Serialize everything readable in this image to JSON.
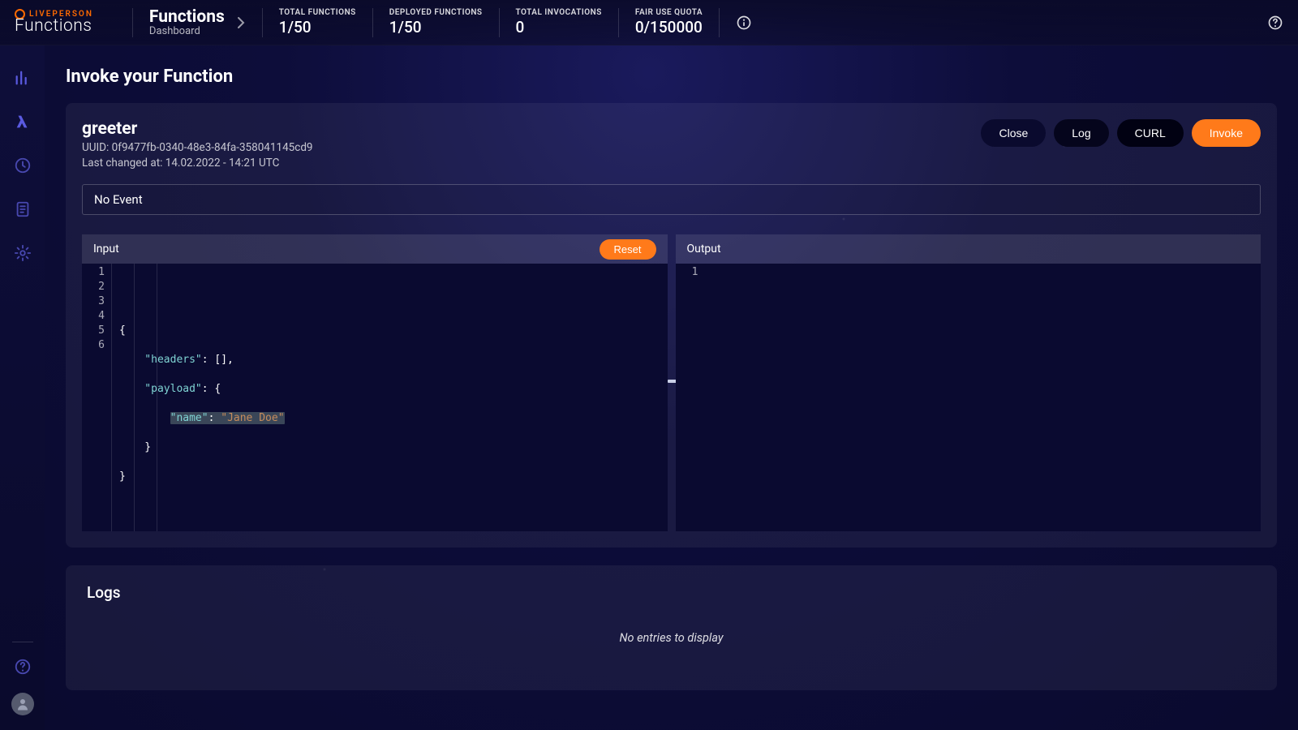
{
  "brand": {
    "word1": "LIVEPERSON",
    "word2": "Functions"
  },
  "breadcrumb": {
    "title": "Functions",
    "subtitle": "Dashboard"
  },
  "stats": {
    "total_functions": {
      "label": "TOTAL FUNCTIONS",
      "value": "1/50"
    },
    "deployed_functions": {
      "label": "DEPLOYED FUNCTIONS",
      "value": "1/50"
    },
    "total_invocations": {
      "label": "TOTAL INVOCATIONS",
      "value": "0"
    },
    "fair_use_quota": {
      "label": "FAIR USE QUOTA",
      "value": "0/150000"
    }
  },
  "page": {
    "title": "Invoke your Function"
  },
  "function": {
    "name": "greeter",
    "uuid_label": "UUID: 0f9477fb-0340-48e3-84fa-358041145cd9",
    "last_changed": "Last changed at: 14.02.2022 - 14:21 UTC"
  },
  "actions": {
    "close": "Close",
    "log": "Log",
    "curl": "CURL",
    "invoke": "Invoke"
  },
  "event_selector": {
    "value": "No Event"
  },
  "input_pane": {
    "title": "Input",
    "reset": "Reset",
    "lines": [
      "1",
      "2",
      "3",
      "4",
      "5",
      "6"
    ],
    "code": {
      "l1": "{",
      "l2a": "    \"headers\"",
      "l2b": ": [],",
      "l3a": "    \"payload\"",
      "l3b": ": {",
      "l4a": "        ",
      "l4b": "\"name\"",
      "l4c": ": ",
      "l4d": "\"Jane Doe\"",
      "l5": "    }",
      "l6": "}"
    }
  },
  "output_pane": {
    "title": "Output",
    "lines": [
      "1"
    ]
  },
  "logs": {
    "title": "Logs",
    "empty": "No entries to display"
  }
}
